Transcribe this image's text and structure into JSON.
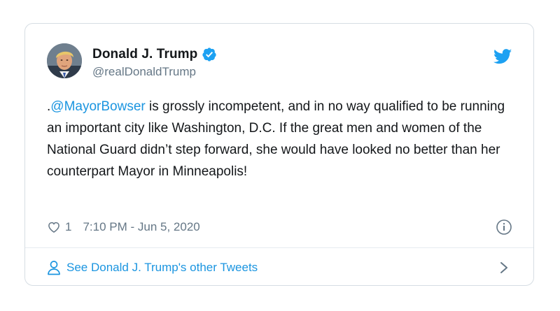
{
  "author": {
    "display_name": "Donald J. Trump",
    "handle": "@realDonaldTrump",
    "verified": true,
    "avatar_icon": "profile-photo"
  },
  "tweet": {
    "prefix": ".",
    "mention": "@MayorBowser",
    "body": " is grossly incompetent, and in no way qualified to be running an important city like Washington, D.C. If the great men and women of the National Guard didn’t step forward, she would have looked no better than her counterpart Mayor in Minneapolis!"
  },
  "meta": {
    "like_count": "1",
    "timestamp": "7:10 PM - Jun 5, 2020",
    "heart_icon": "heart-icon",
    "info_icon": "info-icon"
  },
  "footer": {
    "link_label": "See Donald J. Trump's other Tweets",
    "person_icon": "person-icon",
    "chevron_icon": "chevron-right-icon"
  },
  "colors": {
    "link_blue": "#1b95e0",
    "twitter_blue": "#1da1f2",
    "text_dark": "#14171a",
    "text_gray": "#657786",
    "border": "#d6dde3"
  }
}
